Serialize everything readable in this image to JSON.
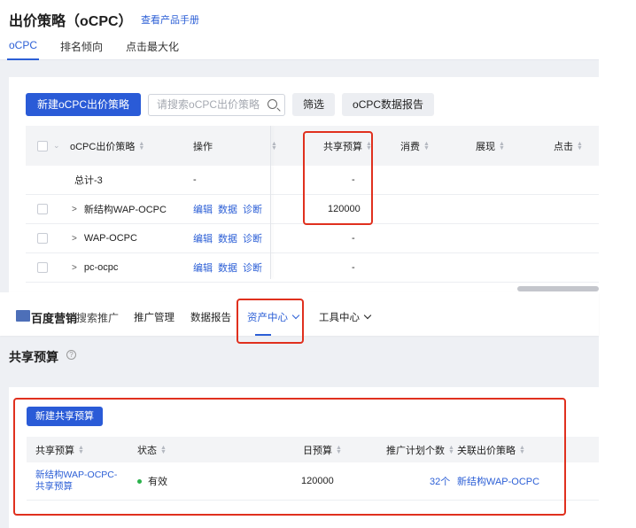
{
  "top": {
    "title": "出价策略（oCPC）",
    "manual_link": "查看产品手册",
    "tabs": [
      "oCPC",
      "排名倾向",
      "点击最大化"
    ],
    "toolbar": {
      "new_button": "新建oCPC出价策略",
      "search_placeholder": "请搜索oCPC出价策略",
      "filter_button": "筛选",
      "report_button": "oCPC数据报告"
    },
    "table": {
      "headers": {
        "strategy": "oCPC出价策略",
        "ops": "操作",
        "shared_budget": "共享预算",
        "cost": "消费",
        "impressions": "展现",
        "clicks": "点击"
      },
      "total_row": {
        "name": "总计-3",
        "ops": "-",
        "budget": "-"
      },
      "rows": [
        {
          "expand": ">",
          "name": "新结构WAP-OCPC",
          "actions": [
            "编辑",
            "数据",
            "诊断"
          ],
          "budget": "120000"
        },
        {
          "expand": ">",
          "name": "WAP-OCPC",
          "actions": [
            "编辑",
            "数据",
            "诊断"
          ],
          "budget": "-"
        },
        {
          "expand": ">",
          "name": "pc-ocpc",
          "actions": [
            "编辑",
            "数据",
            "诊断"
          ],
          "budget": "-"
        }
      ]
    }
  },
  "bottom": {
    "logo": {
      "name": "百度营销",
      "sub": "搜索推广"
    },
    "nav": [
      "推广管理",
      "数据报告",
      "资产中心",
      "工具中心"
    ],
    "section_title": "共享预算",
    "help_icon": "?",
    "new_button": "新建共享预算",
    "table": {
      "headers": {
        "name": "共享预算",
        "status": "状态",
        "daily": "日预算",
        "plans": "推广计划个数",
        "strategy": "关联出价策略"
      },
      "row": {
        "name": "新结构WAP-OCPC-共享预算",
        "status": "有效",
        "daily": "120000",
        "plans": "32个",
        "strategy": "新结构WAP-OCPC"
      }
    }
  },
  "colors": {
    "accent": "#2a5bd7",
    "link": "#2c5fd6",
    "highlight": "#e0301e",
    "status_ok": "#2bb24c"
  }
}
